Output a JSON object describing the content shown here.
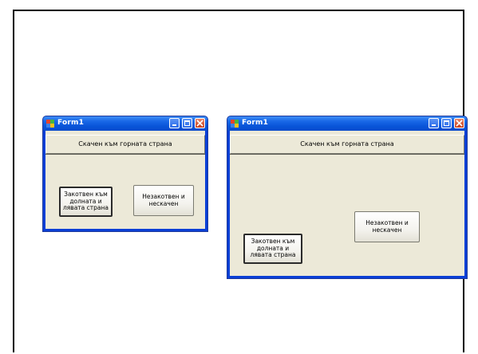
{
  "windows": [
    {
      "title": "Form1",
      "docked_button": "Скачен към горната страна",
      "anchored_button": "Закотвен към долната и лявата страна",
      "free_button": "Незакотвен и нескачен"
    },
    {
      "title": "Form1",
      "docked_button": "Скачен към горната страна",
      "anchored_button": "Закотвен към долната и лявата страна",
      "free_button": "Незакотвен и нескачен"
    }
  ],
  "colors": {
    "titlebar": "#0a54d8",
    "client": "#ece9d8",
    "close_button": "#c8401d"
  }
}
